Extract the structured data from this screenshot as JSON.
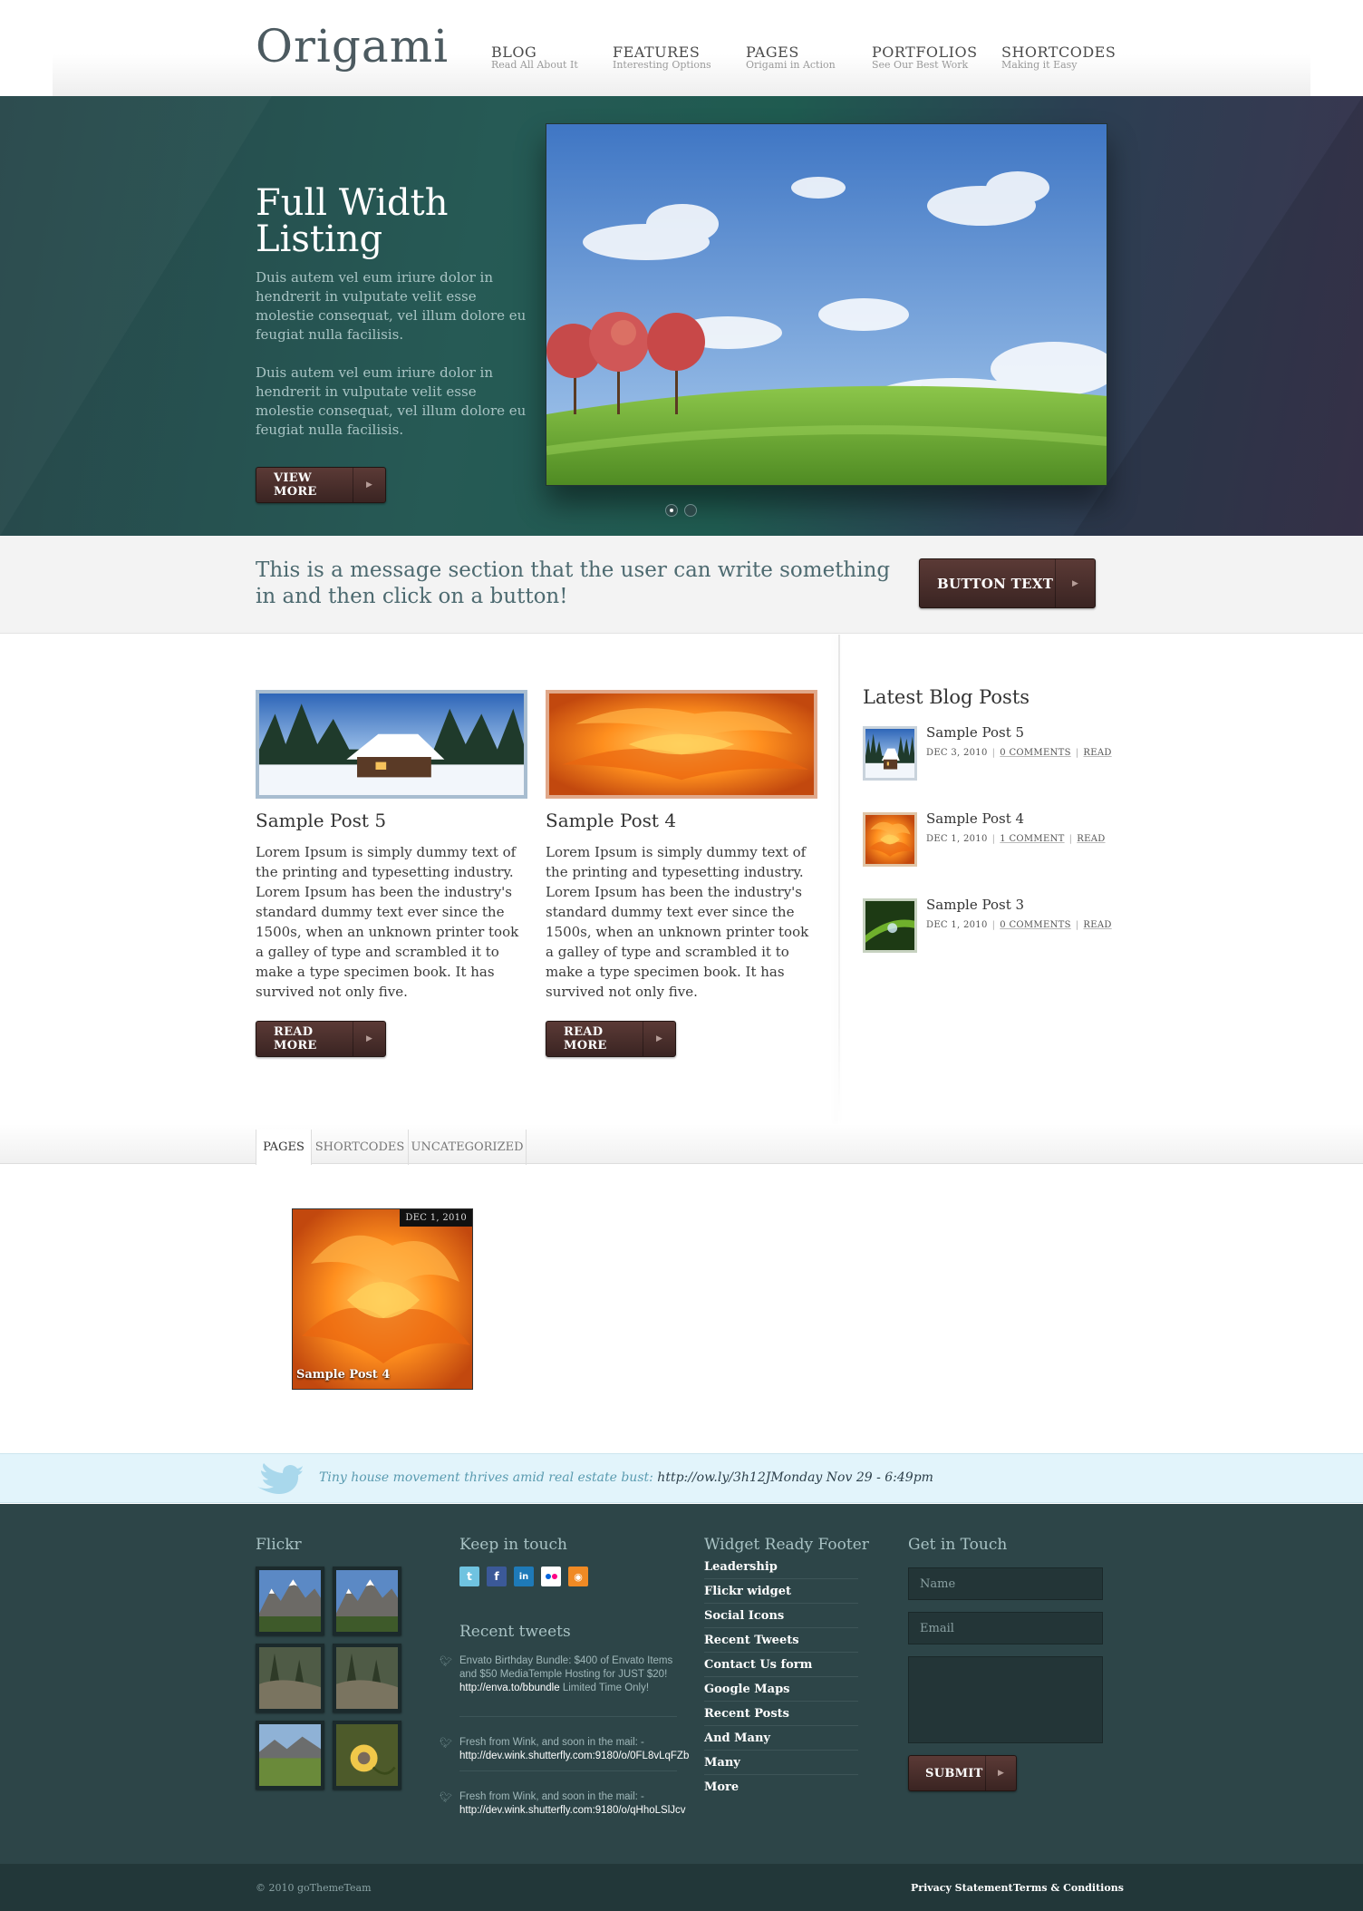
{
  "header": {
    "logo": "Origami",
    "nav": [
      {
        "title": "BLOG",
        "subtitle": "Read All About It"
      },
      {
        "title": "FEATURES",
        "subtitle": "Interesting Options"
      },
      {
        "title": "PAGES",
        "subtitle": "Origami in Action"
      },
      {
        "title": "PORTFOLIOS",
        "subtitle": "See Our Best Work"
      },
      {
        "title": "SHORTCODES",
        "subtitle": "Making it Easy"
      }
    ]
  },
  "hero": {
    "title": "Full Width Listing",
    "paragraphs": [
      "Duis autem vel eum iriure dolor in hendrerit in vulputate velit esse molestie consequat, vel illum dolore eu feugiat nulla facilisis.",
      "Duis autem vel eum iriure dolor in hendrerit in vulputate velit esse molestie consequat, vel illum dolore eu feugiat nulla facilisis."
    ],
    "button": "VIEW MORE",
    "slide_count": 2,
    "active_slide": 1
  },
  "message": {
    "text": "This is a message section that the user can write something in and then click on a button!",
    "button": "BUTTON TEXT"
  },
  "posts": [
    {
      "title": "Sample Post 5",
      "body": "Lorem Ipsum is simply dummy text of the printing and typesetting industry. Lorem Ipsum has been the industry's standard dummy text ever since the 1500s, when an unknown printer took a galley of type and scrambled it to make a type specimen book. It has survived not only five.",
      "button": "READ MORE"
    },
    {
      "title": "Sample Post 4",
      "body": "Lorem Ipsum is simply dummy text of the printing and typesetting industry. Lorem Ipsum has been the industry's standard dummy text ever since the 1500s, when an unknown printer took a galley of type and scrambled it to make a type specimen book. It has survived not only five.",
      "button": "READ MORE"
    }
  ],
  "sidebar": {
    "title": "Latest Blog Posts",
    "items": [
      {
        "title": "Sample Post 5",
        "date": "DEC 3, 2010",
        "comments": "0 COMMENTS",
        "read": "READ"
      },
      {
        "title": "Sample Post 4",
        "date": "DEC 1, 2010",
        "comments": "1 COMMENT",
        "read": "READ"
      },
      {
        "title": "Sample Post 3",
        "date": "DEC 1, 2010",
        "comments": "0 COMMENTS",
        "read": "READ"
      }
    ]
  },
  "tabs": [
    "PAGES",
    "SHORTCODES",
    "UNCATEGORIZED"
  ],
  "portfolio": {
    "date": "DEC 1, 2010",
    "caption": "Sample Post 4"
  },
  "twitter_bar": {
    "text": "Tiny house movement thrives amid real estate bust: ",
    "link": "http://ow.ly/3h12J",
    "time": "Monday Nov 29 - 6:49pm"
  },
  "footer": {
    "flickr_title": "Flickr",
    "keep_title": "Keep in touch",
    "social": [
      "twitter-icon",
      "facebook-icon",
      "linkedin-icon",
      "flickr-icon",
      "rss-icon"
    ],
    "recent_tweets_title": "Recent tweets",
    "tweets": [
      {
        "text": "Envato Birthday Bundle: $400 of Envato Items and $50 MediaTemple Hosting for JUST $20! ",
        "link": "http://enva.to/bbundle",
        "tail": " Limited Time Only!"
      },
      {
        "text": "Fresh from Wink, and soon in the mail: - ",
        "link": "http://dev.wink.shutterfly.com:9180/o/0FL8vLqFZb",
        "tail": ""
      },
      {
        "text": "Fresh from Wink, and soon in the mail: - ",
        "link": "http://dev.wink.shutterfly.com:9180/o/qHhoLSlJcv",
        "tail": ""
      }
    ],
    "widget_title": "Widget Ready Footer",
    "widget_links": [
      "Leadership",
      "Flickr widget",
      "Social Icons",
      "Recent Tweets",
      "Contact Us form",
      "Google Maps",
      "Recent Posts",
      "And Many",
      "Many",
      "More"
    ],
    "contact_title": "Get in Touch",
    "name_placeholder": "Name",
    "email_placeholder": "Email",
    "submit": "SUBMIT"
  },
  "bottom": {
    "copyright": "© 2010 goThemeTeam",
    "links": [
      "Privacy Statement",
      "Terms & Conditions"
    ]
  },
  "colors": {
    "hero_bg": "#265a55",
    "button": "#4a2e2b",
    "footer": "#2d4548",
    "twitter_bar": "#e2f4fb"
  }
}
